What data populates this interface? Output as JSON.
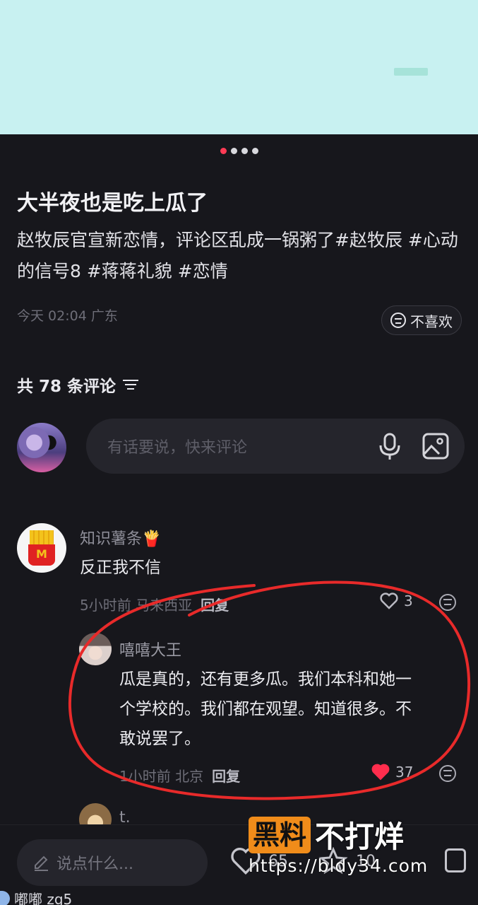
{
  "post": {
    "title": "大半夜也是吃上瓜了",
    "body": "赵牧辰官宣新恋情，评论区乱成一锅粥了#赵牧辰 #心动的信号8 #蒋蒋礼貌 #恋情",
    "meta": "今天 02:04 广东",
    "dislike_label": "不喜欢"
  },
  "carousel": {
    "pages": 4,
    "active": 1
  },
  "comments_header": {
    "count_label": "共 78 条评论"
  },
  "comment_input": {
    "placeholder": "有话要说，快来评论"
  },
  "comments": [
    {
      "name": "知识薯条🍟",
      "text": "反正我不信",
      "meta": "5小时前 马来西亚",
      "reply_label": "回复",
      "likes": "3",
      "liked": false,
      "replies": [
        {
          "name": "嘻嘻大王",
          "text_line1": "瓜是真的，还有更多瓜。我们本科和她一",
          "text_line2": "个学校的。我们都在观望。知道很多。不",
          "text_line3": "敢说罢了。",
          "meta": "1小时前 北京",
          "reply_label": "回复",
          "likes": "37",
          "liked": true
        }
      ]
    },
    {
      "name": "t.",
      "partial": true
    }
  ],
  "bottom_bar": {
    "say_placeholder": "说点什么...",
    "like_count": "65",
    "star_count": "10"
  },
  "watermark": {
    "box": "黑料",
    "text": "不打烊",
    "url": "https://bldy34.com"
  },
  "bottom_user": {
    "name": "嘟嘟 zg5"
  },
  "colors": {
    "accent": "#ff3b55",
    "background": "#17171c",
    "annotation_red": "#e82a2a"
  }
}
